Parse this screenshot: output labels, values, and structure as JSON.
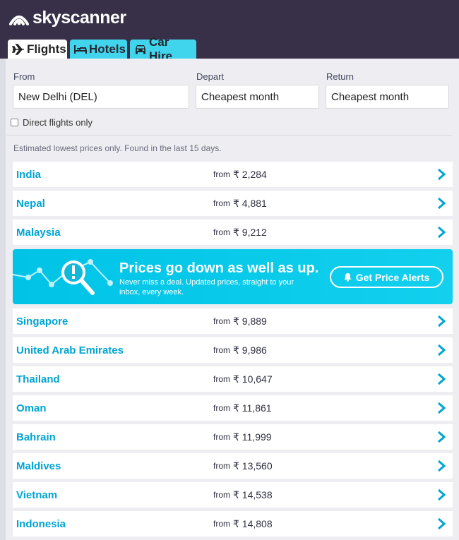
{
  "brand": {
    "name": "skyscanner"
  },
  "tabs": [
    {
      "label": "Flights",
      "icon": "plane-icon",
      "active": true
    },
    {
      "label": "Hotels",
      "icon": "bed-icon",
      "active": false
    },
    {
      "label": "Car Hire",
      "icon": "car-icon",
      "active": false
    }
  ],
  "search": {
    "from_label": "From",
    "from_value": "New Delhi (DEL)",
    "depart_label": "Depart",
    "depart_value": "Cheapest month",
    "return_label": "Return",
    "return_value": "Cheapest month",
    "direct_label": "Direct flights only",
    "direct_checked": false
  },
  "note": "Estimated lowest prices only. Found in the last 15 days.",
  "results": [
    {
      "country": "India",
      "from": "from",
      "price": "₹ 2,284"
    },
    {
      "country": "Nepal",
      "from": "from",
      "price": "₹ 4,881"
    },
    {
      "country": "Malaysia",
      "from": "from",
      "price": "₹ 9,212"
    },
    {
      "country": "Singapore",
      "from": "from",
      "price": "₹ 9,889"
    },
    {
      "country": "United Arab Emirates",
      "from": "from",
      "price": "₹ 9,986"
    },
    {
      "country": "Thailand",
      "from": "from",
      "price": "₹ 10,647"
    },
    {
      "country": "Oman",
      "from": "from",
      "price": "₹ 11,861"
    },
    {
      "country": "Bahrain",
      "from": "from",
      "price": "₹ 11,999"
    },
    {
      "country": "Maldives",
      "from": "from",
      "price": "₹ 13,560"
    },
    {
      "country": "Vietnam",
      "from": "from",
      "price": "₹ 14,538"
    },
    {
      "country": "Indonesia",
      "from": "from",
      "price": "₹ 14,808"
    }
  ],
  "banner": {
    "headline": "Prices go down as well as up.",
    "subtext": "Never miss a deal. Updated prices, straight to your inbox, every week.",
    "button_label": "Get Price Alerts",
    "icon": "price-search-icon"
  },
  "colors": {
    "header_bg": "#373048",
    "accent": "#00a4d3",
    "tab_inactive": "#41d5ed",
    "banner": "#00c3e6"
  }
}
